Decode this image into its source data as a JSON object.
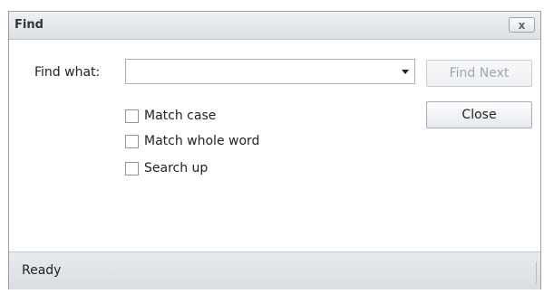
{
  "window": {
    "title": "Find",
    "close_glyph": "x"
  },
  "find": {
    "label": "Find what:",
    "value": "",
    "placeholder": "",
    "dropdown_icon": "chevron-down-icon"
  },
  "buttons": {
    "find_next": "Find Next",
    "find_next_enabled": false,
    "close": "Close"
  },
  "options": [
    {
      "label": "Match case",
      "checked": false
    },
    {
      "label": "Match whole word",
      "checked": false
    },
    {
      "label": "Search up",
      "checked": false
    }
  ],
  "status": {
    "text": "Ready"
  },
  "colors": {
    "titlebar": "#e3e6ea",
    "statusbar": "#dfe2e6",
    "disabled_text": "#a0a6ad"
  }
}
